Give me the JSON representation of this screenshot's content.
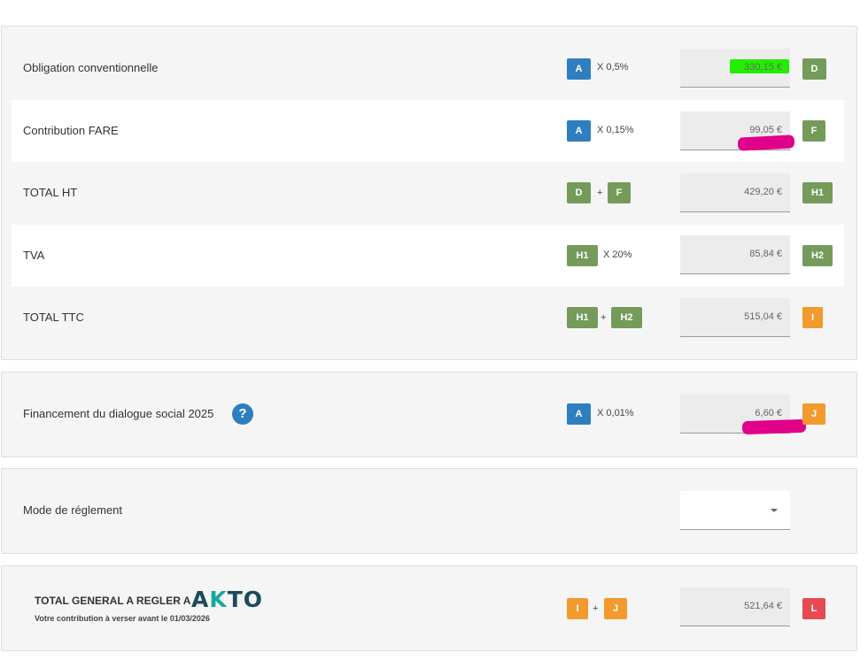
{
  "colors": {
    "blue": "#2f7ec0",
    "green": "#749b5a",
    "orange": "#f29a2e",
    "red": "#e64950",
    "highlight_green": "#22ee00",
    "highlight_pink": "#e0008a"
  },
  "rows": {
    "obligation": {
      "label": "Obligation conventionnelle",
      "badge1": "A",
      "op": "X 0,5%",
      "value": "330,15 €",
      "result": "D"
    },
    "fare": {
      "label": "Contribution FARE",
      "badge1": "A",
      "op": "X 0,15%",
      "value": "99,05 €",
      "result": "F"
    },
    "total_ht": {
      "label": "TOTAL HT",
      "badge1": "D",
      "op": "+",
      "badge2": "F",
      "value": "429,20 €",
      "result": "H1"
    },
    "tva": {
      "label": "TVA",
      "badge1": "H1",
      "op": "X 20%",
      "value": "85,84 €",
      "result": "H2"
    },
    "total_ttc": {
      "label": "TOTAL TTC",
      "badge1": "H1",
      "op": "+",
      "badge2": "H2",
      "value": "515,04 €",
      "result": "I"
    }
  },
  "financement": {
    "label": "Financement du dialogue social 2025",
    "help_icon": "question-icon",
    "help": "?",
    "badge1": "A",
    "op": "X 0,01%",
    "value": "6,60 €",
    "result": "J"
  },
  "mode": {
    "label": "Mode de réglement",
    "selected": "",
    "icon": "chevron-down-icon"
  },
  "total_general": {
    "title": "TOTAL GENERAL A REGLER A",
    "logo_left": "A",
    "logo_k": "K",
    "logo_right": "TO",
    "subtitle": "Votre contribution à verser avant le 01/03/2026",
    "badge1": "I",
    "op": "+",
    "badge2": "J",
    "value": "521,64 €",
    "result": "L"
  }
}
